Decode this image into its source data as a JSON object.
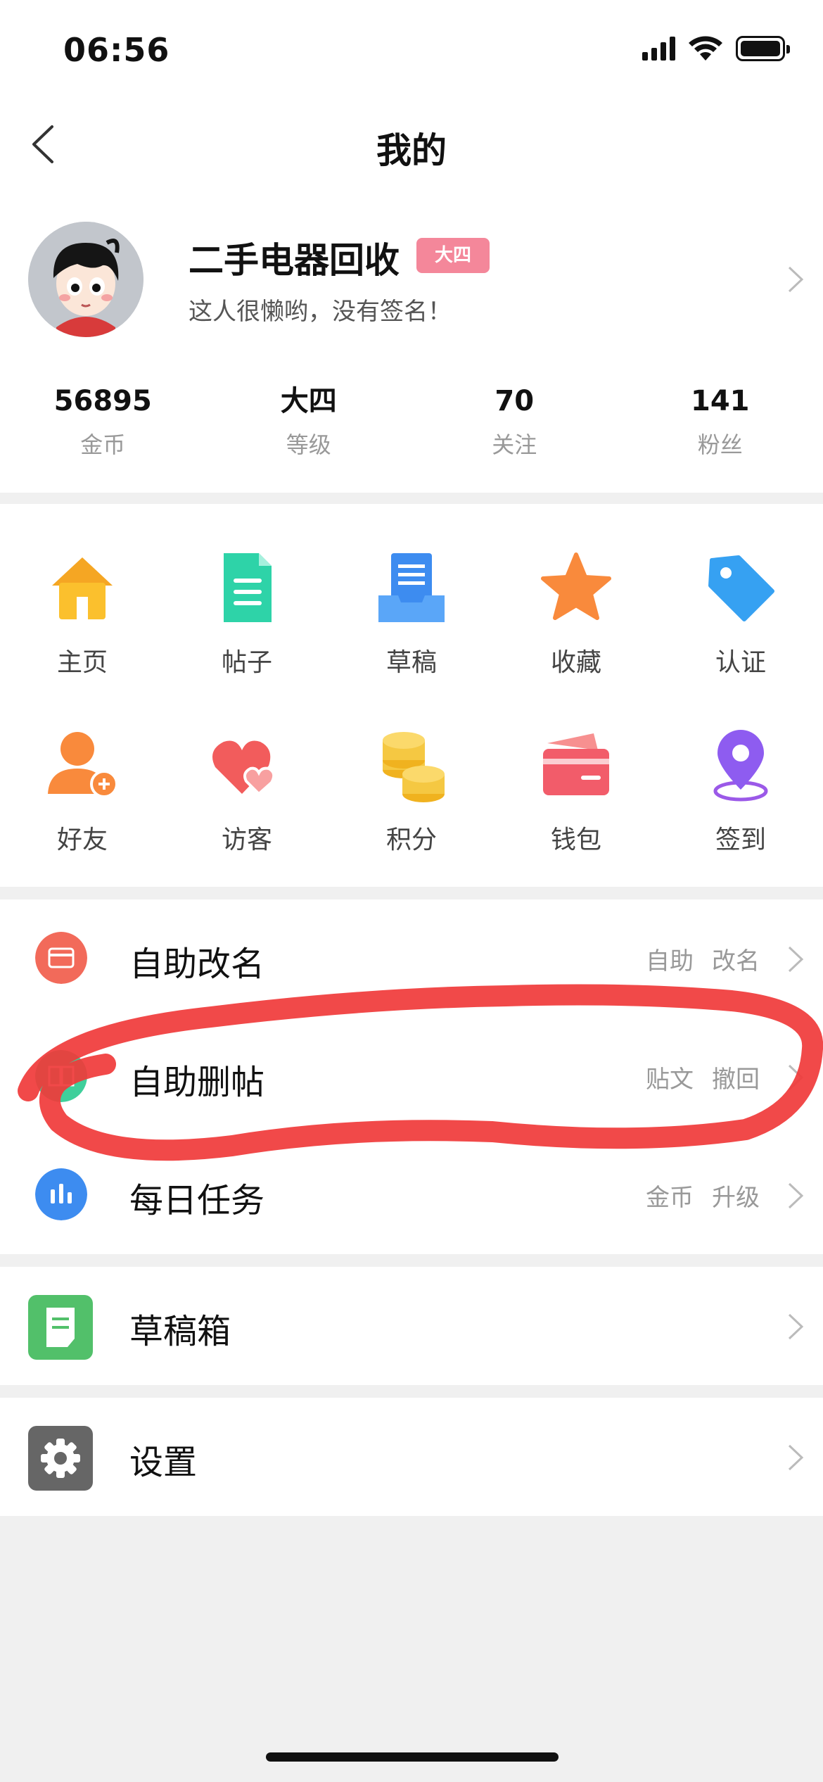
{
  "status_bar": {
    "time": "06:56"
  },
  "nav": {
    "title": "我的"
  },
  "profile": {
    "name": "二手电器回收",
    "level_badge": "大四",
    "signature": "这人很懒哟，没有签名！"
  },
  "stats": [
    {
      "value": "56895",
      "label": "金币"
    },
    {
      "value": "大四",
      "label": "等级"
    },
    {
      "value": "70",
      "label": "关注"
    },
    {
      "value": "141",
      "label": "粉丝"
    }
  ],
  "grid": [
    {
      "label": "主页",
      "icon": "home-icon"
    },
    {
      "label": "帖子",
      "icon": "document-icon"
    },
    {
      "label": "草稿",
      "icon": "draft-tray-icon"
    },
    {
      "label": "收藏",
      "icon": "star-icon"
    },
    {
      "label": "认证",
      "icon": "tag-icon"
    },
    {
      "label": "好友",
      "icon": "add-friend-icon"
    },
    {
      "label": "访客",
      "icon": "hearts-icon"
    },
    {
      "label": "积分",
      "icon": "coins-icon"
    },
    {
      "label": "钱包",
      "icon": "wallet-icon"
    },
    {
      "label": "签到",
      "icon": "location-pin-icon"
    }
  ],
  "list_primary": [
    {
      "label": "自助改名",
      "tags": [
        "自助",
        "改名"
      ],
      "icon": "card-icon",
      "color": "#f26a5a"
    },
    {
      "label": "自助删帖",
      "tags": [
        "贴文",
        "撤回"
      ],
      "icon": "book-icon",
      "color": "#3fcf9b"
    },
    {
      "label": "每日任务",
      "tags": [
        "金币",
        "升级"
      ],
      "icon": "bar-chart-icon",
      "color": "#3d8cf0"
    }
  ],
  "list_drafts": {
    "label": "草稿箱",
    "icon": "draft-box-icon",
    "color": "#52c06a"
  },
  "list_settings": {
    "label": "设置",
    "icon": "gear-icon",
    "color": "#666666"
  },
  "annotation_color": "#f03a3a"
}
